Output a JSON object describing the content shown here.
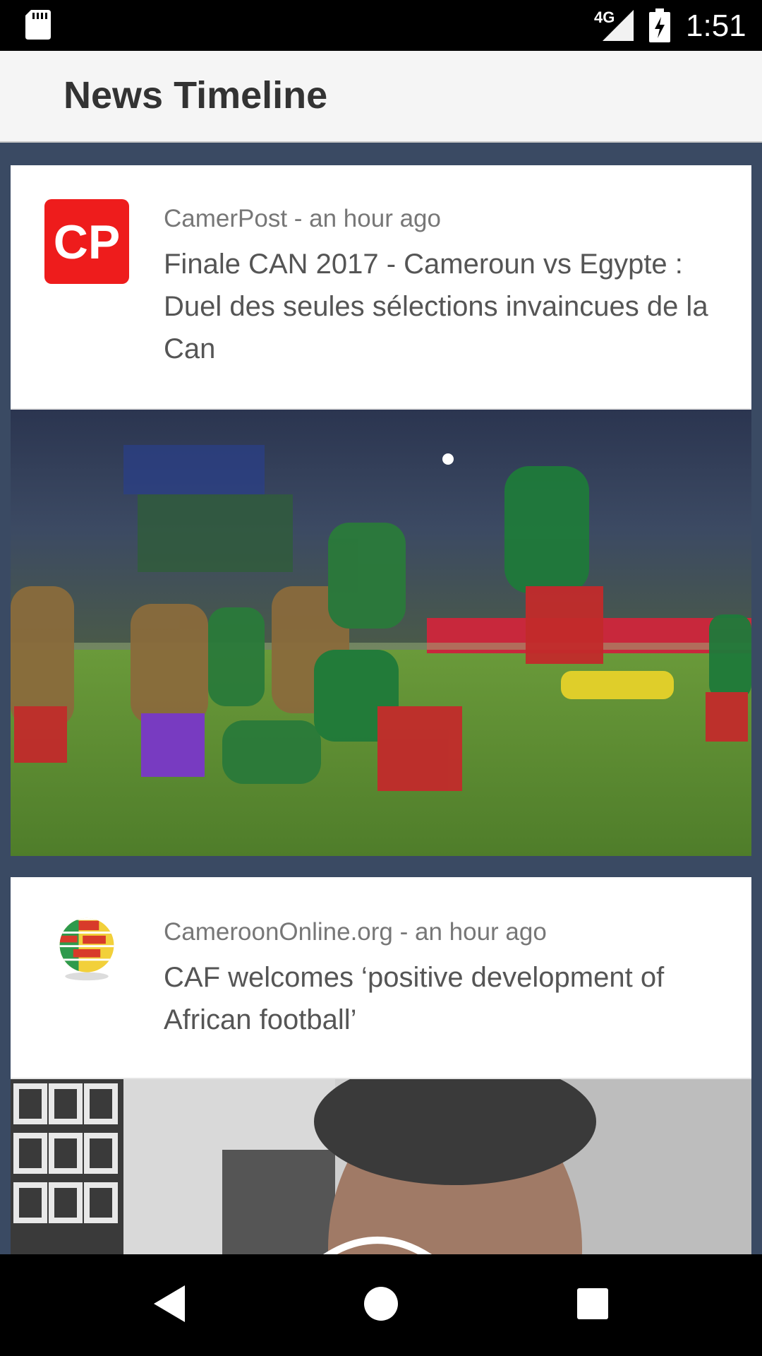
{
  "status_bar": {
    "network": "4G",
    "time": "1:51",
    "icons": [
      "sd-card-icon",
      "signal-icon",
      "battery-charging-icon"
    ]
  },
  "app_bar": {
    "title": "News Timeline"
  },
  "feed": {
    "items": [
      {
        "source": "CamerPost - an hour ago",
        "title": "Finale CAN 2017 - Cameroun vs Egypte : Duel des seules sélections invaincues de la Can",
        "logo_text": "CP",
        "logo_color": "#ee1c1c",
        "image": "football-celebration-photo"
      },
      {
        "source": "CameroonOnline.org - an hour ago",
        "title": "CAF welcomes ‘positive development of African football’",
        "logo": "cameroon-globe-logo",
        "image": "man-portrait-photo"
      }
    ]
  },
  "nav_bar": {
    "buttons": [
      "back-icon",
      "home-icon",
      "recents-icon"
    ]
  },
  "colors": {
    "background": "#3a4a63",
    "app_bar": "#f5f5f5",
    "card": "#ffffff",
    "source_text": "#777777",
    "title_text": "#555555"
  }
}
